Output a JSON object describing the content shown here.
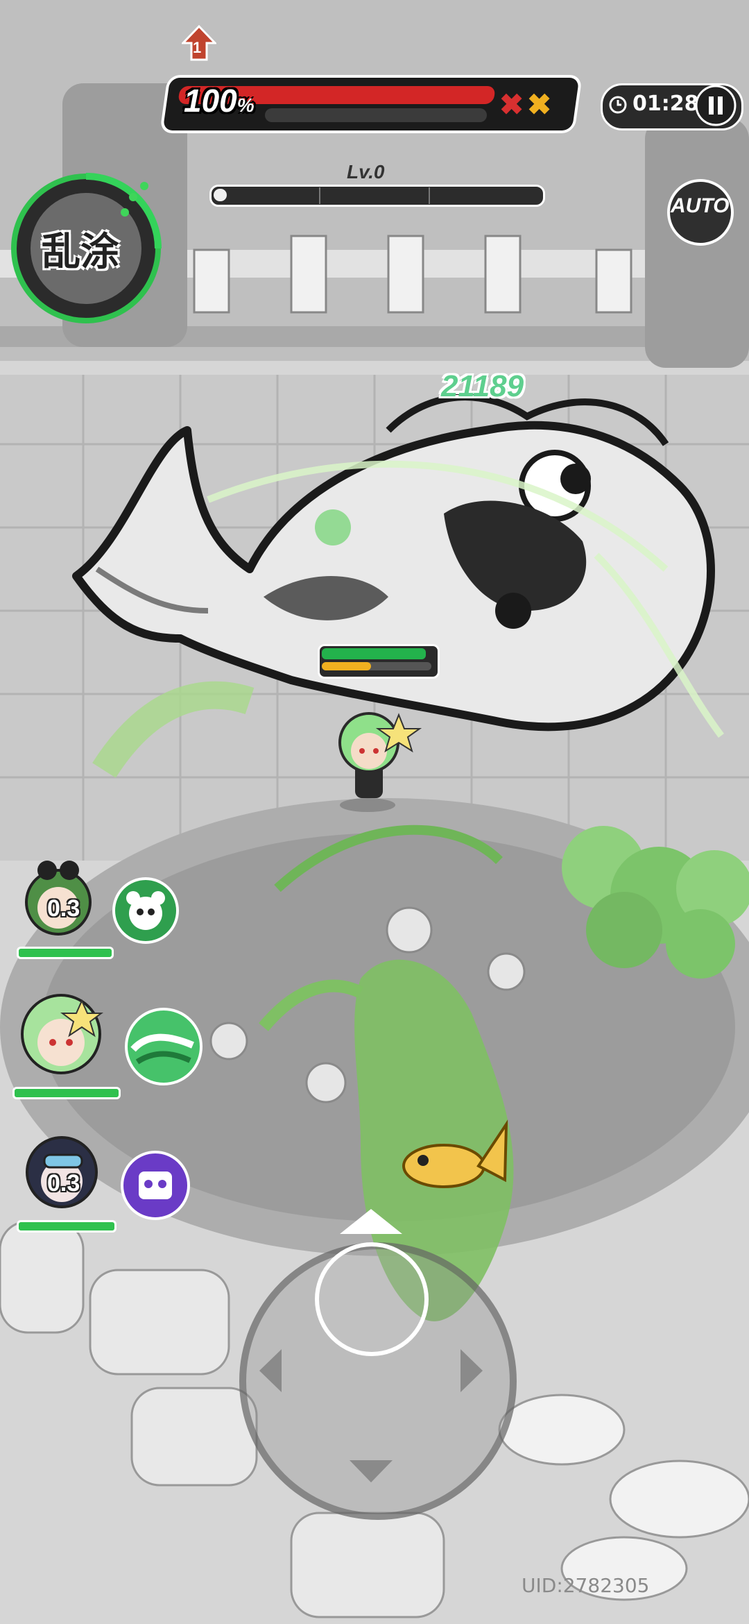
{
  "hud": {
    "boss_hp_percent_label": "100",
    "boss_hp_percent_sign": "%",
    "boss_hp_fraction": 1.0,
    "stage_badge": "1",
    "buff_icons": [
      "red-x-buff-icon",
      "yellow-x-buff-icon"
    ],
    "timer": "01:28",
    "level_label": "Lv.0",
    "xp_fraction": 0.04,
    "auto_label": "AUTO"
  },
  "skill": {
    "label": "乱涂"
  },
  "combat": {
    "damage_number": "21189",
    "boss_hp_fraction": 0.95,
    "boss_shield_fraction": 0.45
  },
  "party": [
    {
      "cooldown": "0.3",
      "skill_icon": "panda-skill-icon",
      "hp_fraction": 1.0
    },
    {
      "cooldown": "",
      "skill_icon": "wave-skill-icon",
      "hp_fraction": 1.0
    },
    {
      "cooldown": "0.3",
      "skill_icon": "robot-skill-icon",
      "hp_fraction": 1.0
    }
  ],
  "footer": {
    "uid": "UID:2782305"
  },
  "colors": {
    "hp_red": "#d32626",
    "party_green": "#2fc14e",
    "damage_green": "#5ecf8e",
    "accent_yellow": "#f0b020"
  }
}
